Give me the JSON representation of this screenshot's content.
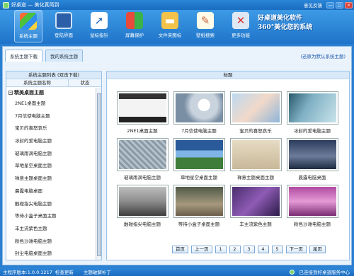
{
  "window": {
    "title": "好桌道 — 美化真简到",
    "feedback": "意见反馈",
    "btn_min": "—",
    "btn_max": "□",
    "btn_close": "×"
  },
  "toolbar": {
    "items": [
      {
        "label": "系统主题",
        "icon": "windows-logo-icon",
        "active": true
      },
      {
        "label": "登陆界面",
        "icon": "login-screen-icon",
        "active": false
      },
      {
        "label": "鼠标指针",
        "icon": "mouse-pointer-icon",
        "active": false
      },
      {
        "label": "屏幕保护",
        "icon": "screensaver-shield-icon",
        "active": false
      },
      {
        "label": "文件夹图标",
        "icon": "folder-icon",
        "active": false
      },
      {
        "label": "壁纸搜索",
        "icon": "wallpaper-search-icon",
        "active": false
      },
      {
        "label": "更多功能",
        "icon": "tools-icon",
        "active": false
      }
    ],
    "brand_line1": "好桌道美化软件",
    "brand_line2": "360°美化您的系统"
  },
  "tabs": [
    {
      "label": "系统主题下载",
      "active": true
    },
    {
      "label": "我的系统主题",
      "active": false
    }
  ],
  "restore_link": "(还原为默认系统主题)",
  "left_panel": {
    "header": "系统主题列表 (双击下载)",
    "col_name": "系统主题名称",
    "col_status": "状态",
    "group": "精美桌面主题",
    "items": [
      "2NE1桌面主题",
      "7月信使电脑主题",
      "宝贝的喜怒哀乐",
      "冰封的爱电脑主题",
      "玻璃雨滴电脑主题",
      "草地星空桌面主题",
      "禅意主题桌面主题",
      "晨露电脑桌面",
      "触碰指尖电脑主题",
      "等待小盒子桌面主题",
      "丰主流紫色主题",
      "粉色沙滩电脑主题",
      "封尘电脑桌面主题"
    ]
  },
  "right_panel": {
    "header": "标题",
    "themes": [
      "2NE1桌面主题",
      "7月信使电脑主题",
      "宝贝的喜怒哀乐",
      "冰封的爱电脑主题",
      "玻璃雨滴电脑主题",
      "草地星空桌面主题",
      "禅意主题桌面主题",
      "晨露电脑桌面",
      "触碰指尖电脑主题",
      "等待小盒子桌面主题",
      "丰主流紫色主题",
      "粉色沙滩电脑主题"
    ]
  },
  "pager": {
    "first": "首页",
    "prev": "上一页",
    "pages": [
      "1",
      "2",
      "3",
      "4",
      "5"
    ],
    "next": "下一页",
    "last": "尾页"
  },
  "status": {
    "version": "主程序版本:1.0.0.1217",
    "update": "检查更新",
    "patch": "主题破解补丁",
    "connected": "已连接到好桌道服务中心"
  }
}
